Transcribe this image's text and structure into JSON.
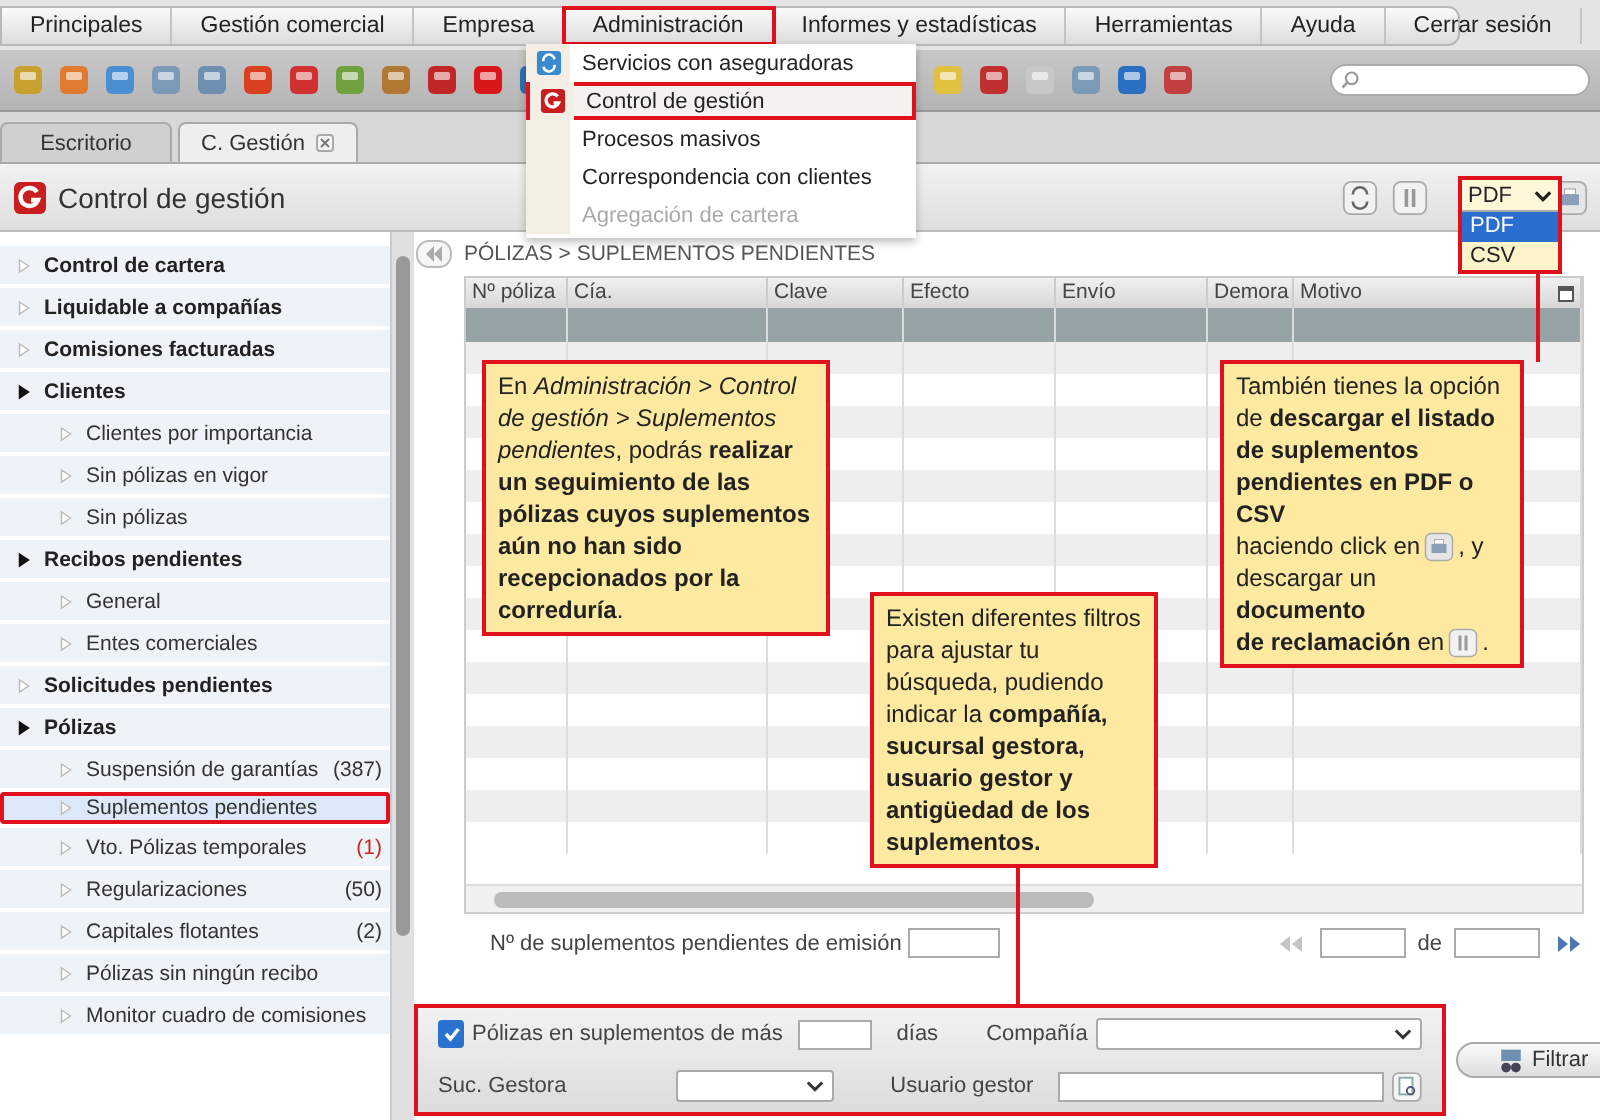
{
  "menu_bar": {
    "items": [
      {
        "label": "Principales",
        "selected": false
      },
      {
        "label": "Gestión comercial",
        "selected": false
      },
      {
        "label": "Empresa",
        "selected": false
      },
      {
        "label": "Administración",
        "selected": true
      },
      {
        "label": "Informes y estadísticas",
        "selected": false
      },
      {
        "label": "Herramientas",
        "selected": false
      },
      {
        "label": "Ayuda",
        "selected": false
      },
      {
        "label": "Cerrar sesión",
        "selected": false
      }
    ]
  },
  "admin_menu": {
    "items": [
      {
        "label": "Servicios con aseguradoras",
        "kind": "sync",
        "highlighted": false,
        "disabled": false
      },
      {
        "label": "Control de gestión",
        "kind": "gestion",
        "highlighted": true,
        "disabled": false
      },
      {
        "label": "Procesos masivos",
        "kind": "text",
        "highlighted": false,
        "disabled": false
      },
      {
        "label": "Correspondencia con clientes",
        "kind": "text",
        "highlighted": false,
        "disabled": false
      },
      {
        "label": "Agregación de cartera",
        "kind": "text",
        "highlighted": false,
        "disabled": true
      }
    ]
  },
  "tabs": [
    {
      "label": "Escritorio",
      "selected": false,
      "closable": false
    },
    {
      "label": "C. Gestión",
      "selected": true,
      "closable": true
    }
  ],
  "header": {
    "title": "Control de gestión",
    "export_format": {
      "value": "PDF",
      "options": [
        {
          "label": "PDF",
          "selected": true
        },
        {
          "label": "CSV",
          "selected": false
        }
      ]
    }
  },
  "sidebar": {
    "items": [
      {
        "label": "Control de cartera",
        "expanded": false,
        "selected": false
      },
      {
        "label": "Liquidable a compañías",
        "expanded": false,
        "selected": false
      },
      {
        "label": "Comisiones facturadas",
        "expanded": false,
        "selected": false
      },
      {
        "label": "Clientes",
        "expanded": true,
        "selected": false,
        "children": [
          {
            "label": "Clientes por importancia",
            "selected": false
          },
          {
            "label": "Sin pólizas en vigor",
            "selected": false
          },
          {
            "label": "Sin pólizas",
            "selected": false
          }
        ]
      },
      {
        "label": "Recibos pendientes",
        "expanded": true,
        "selected": false,
        "children": [
          {
            "label": "General",
            "selected": false
          },
          {
            "label": "Entes comerciales",
            "selected": false
          }
        ]
      },
      {
        "label": "Solicitudes pendientes",
        "expanded": false,
        "selected": false
      },
      {
        "label": "Pólizas",
        "expanded": true,
        "selected": false,
        "children": [
          {
            "label": "Suspensión de garantías",
            "selected": false,
            "count": "(387)",
            "count_alert": false
          },
          {
            "label": "Suplementos pendientes",
            "selected": true
          },
          {
            "label": "Vto. Pólizas temporales",
            "selected": false,
            "count": "(1)",
            "count_alert": true
          },
          {
            "label": "Regularizaciones",
            "selected": false,
            "count": "(50)",
            "count_alert": false
          },
          {
            "label": "Capitales flotantes",
            "selected": false,
            "count": "(2)",
            "count_alert": false
          },
          {
            "label": "Pólizas sin ningún recibo",
            "selected": false
          },
          {
            "label": "Monitor cuadro de comisiones",
            "selected": false
          }
        ]
      }
    ]
  },
  "breadcrumb": "PÓLIZAS > SUPLEMENTOS PENDIENTES",
  "table": {
    "columns": [
      "Nº póliza",
      "Cía.",
      "Clave",
      "Efecto",
      "Envío",
      "Demora",
      "Motivo"
    ]
  },
  "count": {
    "label": "Nº de suplementos pendientes de emisión"
  },
  "pager": {
    "separator": "de"
  },
  "filters": {
    "older_than": {
      "checked": true,
      "label": "Pólizas en suplementos de más",
      "unit": "días"
    },
    "company": {
      "label": "Compañía"
    },
    "branch": {
      "label": "Suc. Gestora"
    },
    "user": {
      "label": "Usuario gestor"
    }
  },
  "filter_button": "Filtrar",
  "callouts": [
    {
      "lines": [
        [
          {
            "kind": "text",
            "text": "En *Administración > Control de gestión > Suplementos pendientes*, podrás **realizar un seguimiento de las pólizas cuyos suplementos aún no han sido recepcionados por la correduría**."
          }
        ]
      ]
    },
    {
      "lines": [
        [
          {
            "kind": "text",
            "text": "También tienes la opción de **descargar el listado de suplementos pendientes en PDF o CSV**"
          }
        ],
        [
          {
            "kind": "text",
            "text": "haciendo click en"
          },
          {
            "kind": "print_icon"
          },
          {
            "kind": "text",
            "text": ", y"
          }
        ],
        [
          {
            "kind": "text",
            "text": "descargar un **documento**"
          }
        ],
        [
          {
            "kind": "text",
            "text": "**de reclamación** en"
          },
          {
            "kind": "document_icon"
          },
          {
            "kind": "text",
            "text": "."
          }
        ]
      ]
    },
    {
      "lines": [
        [
          {
            "kind": "text",
            "text": "Existen diferentes filtros para ajustar tu búsqueda, pudiendo indicar la **compañía, sucursal gestora, usuario gestor y antigüedad de los suplementos.**"
          }
        ]
      ]
    }
  ]
}
